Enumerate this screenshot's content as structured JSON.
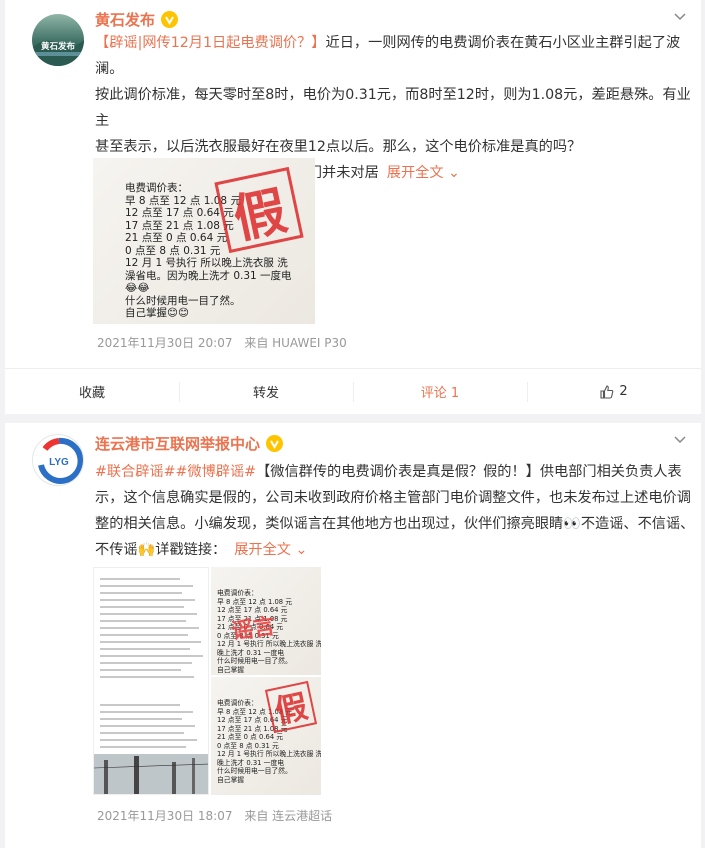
{
  "post1": {
    "author": "黄石发布",
    "avatar_text": "黄石发布",
    "title_tag": "【辟谣|网传12月1日起电费调价？】",
    "line1_rest": "近日，一则网传的电费调价表在黄石小区业主群引起了波",
    "line2": "澜。",
    "line3": "按此调价标准，每天零时至8时，电价为0.31元，而8时至12时，则为1.08元，差距悬殊。有业主",
    "line4": "甚至表示，以后洗衣服最好在夜里12点以后。那么，这个电价标准是真的吗？",
    "line5": "网传的电费调价表为谣言，物价部门并未对居",
    "expand": "展开全文",
    "image_lines": [
      "电费调价表：",
      "早 8 点至 12 点 1.08 元",
      "12 点至 17 点 0.64 元",
      "17 点至 21 点 1.08 元",
      "21 点至 0 点 0.64 元",
      "0 点至 8 点 0.31 元",
      "12 月 1 号执行 所以晚上洗衣服 洗",
      "澡省电。因为晚上洗才 0.31 一度电",
      "😂😂",
      "什么时候用电一目了然。",
      "自己掌握😊😊"
    ],
    "stamp": "假",
    "date": "2021年11月30日 20:07",
    "source": "来自 HUAWEI P30",
    "actions": {
      "fav": "收藏",
      "forward": "转发",
      "comment": "评论 1",
      "like": "2"
    }
  },
  "post2": {
    "author": "连云港市互联网举报中心",
    "avatar_text": "LYG",
    "tag1": "#联合辟谣#",
    "tag2": "#微博辟谣#",
    "line1_rest": "【微信群传的电费调价表是真是假？假的！】供电部门相关负责人表",
    "line2": "示，这个信息确实是假的，公司未收到政府价格主管部门电价调整文件，也未发布过上述电价调",
    "line3": "整的相关信息。小编发现，类似谣言在其他地方也出现过，伙伴们擦亮眼睛👀不造谣、不信谣、",
    "line4_start": "不传谣",
    "line4_mid": "详戳链接：",
    "expand": "展开全文",
    "img_rumor": "谣言",
    "img_note_lines": [
      "电费调价表：",
      "早 8 点至 12 点 1.08 元",
      "12 点至 17 点 0.64 元",
      "17 点至 21 点 1.08 元",
      "21 点至 0 点 0.64 元",
      "0 点至 8 点 0.31 元",
      "12 月 1 号执行 所以晚上洗衣服 洗澡省电。因为",
      "晚上洗才 0.31 一度电",
      "什么时候用电一目了然。",
      "自己掌握"
    ],
    "img_stamp": "假",
    "date": "2021年11月30日 18:07",
    "source": "来自 连云港超话"
  },
  "colors": {
    "accent": "#eb7350",
    "verified": "#ffc400"
  }
}
